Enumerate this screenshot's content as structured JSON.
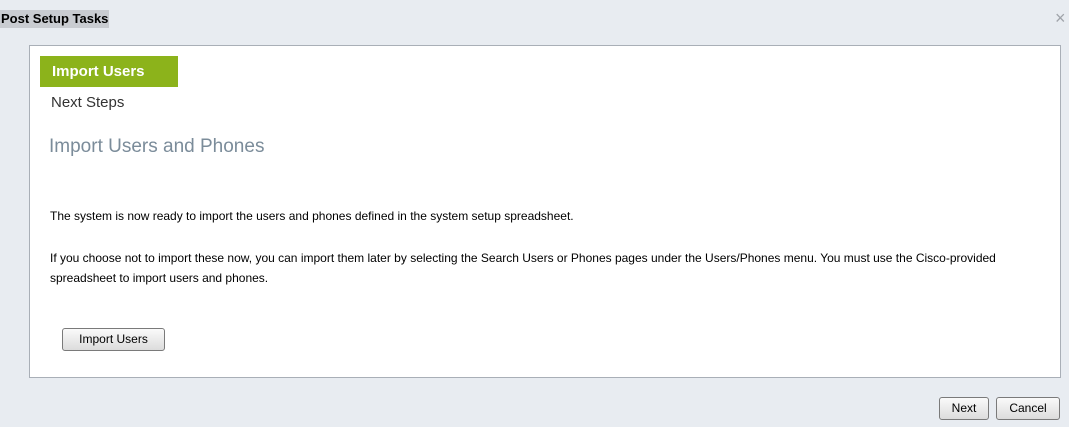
{
  "dialog": {
    "title": "Post Setup Tasks",
    "close_glyph": "×"
  },
  "steps": {
    "active_label": "Import Users",
    "next_label": "Next Steps"
  },
  "content": {
    "heading": "Import Users and Phones",
    "paragraph_1": "The system is now ready to import the users and phones defined in the system setup spreadsheet.",
    "paragraph_2": "If you choose not to import these now, you can import them later by selecting the Search Users or Phones pages under the Users/Phones menu. You must use the Cisco-provided spreadsheet to import users and phones.",
    "import_button_label": "Import Users"
  },
  "footer": {
    "next_label": "Next",
    "cancel_label": "Cancel"
  },
  "colors": {
    "active_step": "#8cb31b",
    "heading": "#7b8c9a",
    "background": "#e8ecf1"
  },
  "icons": {
    "close": "close-icon"
  }
}
